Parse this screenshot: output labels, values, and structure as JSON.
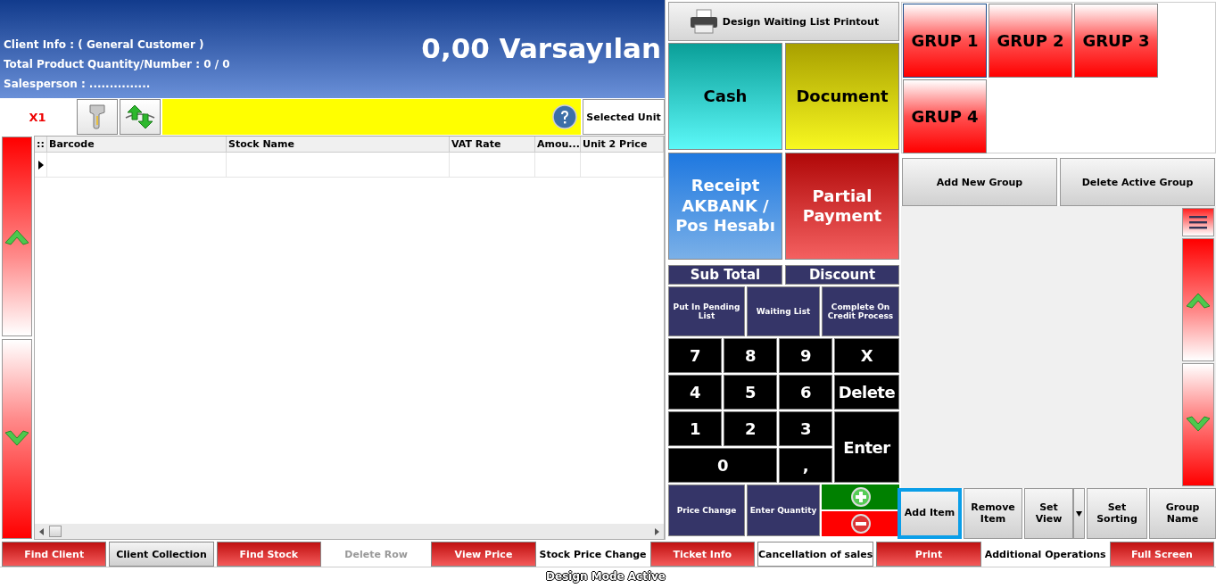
{
  "header": {
    "client_info": "Client Info : ( General Customer )",
    "product_quantity": "Total Product Quantity/Number : 0 / 0",
    "salesperson": "Salesperson : ...............",
    "total": "0,00 Varsayılan"
  },
  "toolbar": {
    "multiplier": "X1",
    "unit_button": "Selected Unit"
  },
  "table": {
    "columns": [
      "::",
      "Barcode",
      "Stock Name",
      "VAT Rate",
      "Amou...",
      "Unit 2 Price"
    ]
  },
  "print_design_button": "Design Waiting List Printout",
  "payment_buttons": [
    {
      "label": "Cash",
      "kind": "cash"
    },
    {
      "label": "Document",
      "kind": "document"
    },
    {
      "label": "Receipt AKBANK / Pos Hesabı",
      "kind": "card"
    },
    {
      "label": "Partial Payment",
      "kind": "partial"
    }
  ],
  "totals": [
    "Sub Total",
    "Discount"
  ],
  "process_buttons": [
    "Put In Pending List",
    "Waiting List",
    "Complete On Credit Process"
  ],
  "keypad": [
    {
      "label": "7",
      "kind": "key"
    },
    {
      "label": "8",
      "kind": "key"
    },
    {
      "label": "9",
      "kind": "key"
    },
    {
      "label": "X",
      "kind": "key"
    },
    {
      "label": "4",
      "kind": "key"
    },
    {
      "label": "5",
      "kind": "key"
    },
    {
      "label": "6",
      "kind": "key"
    },
    {
      "label": "Delete",
      "kind": "key"
    },
    {
      "label": "1",
      "kind": "key"
    },
    {
      "label": "2",
      "kind": "key"
    },
    {
      "label": "3",
      "kind": "key"
    },
    {
      "label": "Enter",
      "kind": "tall"
    },
    {
      "label": "0",
      "kind": "wide"
    },
    {
      "label": ",",
      "kind": "key"
    }
  ],
  "quantity_buttons": [
    "Price Change",
    "Enter Quantity"
  ],
  "groups": [
    {
      "label": "GRUP 1",
      "selected": true
    },
    {
      "label": "GRUP 2",
      "selected": false
    },
    {
      "label": "GRUP 3",
      "selected": false
    },
    {
      "label": "GRUP 4",
      "selected": false
    }
  ],
  "group_actions": [
    "Add New Group",
    "Delete Active Group"
  ],
  "item_actions": [
    {
      "label": "Add Item",
      "kind": "button",
      "selected": true
    },
    {
      "label": "Remove Item",
      "kind": "button",
      "selected": false
    },
    {
      "label": "Set View",
      "kind": "dropdown",
      "selected": false
    },
    {
      "label": "Set Sorting",
      "kind": "button",
      "selected": false
    },
    {
      "label": "Group Name",
      "kind": "button",
      "selected": false
    }
  ],
  "bottom_bar": [
    {
      "label": "Find Client",
      "kind": "red",
      "disabled": false
    },
    {
      "label": "Client Collection",
      "kind": "gray",
      "disabled": false
    },
    {
      "label": "Find Stock",
      "kind": "red",
      "disabled": false
    },
    {
      "label": "Delete Row",
      "kind": "plain",
      "disabled": true
    },
    {
      "label": "View Price",
      "kind": "red",
      "disabled": false
    },
    {
      "label": "Stock Price Change",
      "kind": "plain",
      "disabled": false
    },
    {
      "label": "Ticket Info",
      "kind": "red",
      "disabled": false
    },
    {
      "label": "Cancellation of sales",
      "kind": "outline",
      "disabled": false
    },
    {
      "label": "Print",
      "kind": "red",
      "disabled": false
    },
    {
      "label": "Additional Operations",
      "kind": "plain",
      "disabled": false
    },
    {
      "label": "Full Screen",
      "kind": "red",
      "disabled": false
    }
  ],
  "status": "Design Mode Active"
}
